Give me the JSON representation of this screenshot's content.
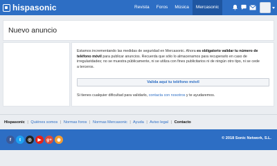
{
  "header": {
    "logo_text": "hispasonic",
    "nav": [
      "Revista",
      "Foros",
      "Música",
      "Mercasonic"
    ],
    "icons": [
      "bell-icon",
      "chat-icon",
      "mail-icon"
    ]
  },
  "page": {
    "title": "Nuevo anuncio"
  },
  "notice": {
    "part1": "Estamos incrementando las medidas de seguridad en Mercasonic. Ahora ",
    "bold": "es obligatorio validar tu número de teléfono móvil",
    "part2": " para publicar anuncios. Recuerda que sólo lo almacenamos para recuperarlo en caso de irregularidades; no se muestra públicamente, ni se utiliza con fines publicitarios ni de ningún otro tipo, ni se cede a terceros."
  },
  "verify_button": "Valida aquí tu teléfono móvil",
  "help": {
    "before": "Si tienes cualquier dificultad para validarlo, ",
    "link": "contacta con nosotros",
    "after": " y te ayudaremos."
  },
  "footer": {
    "brand": "Hispasonic",
    "links": [
      "Quiénes somos",
      "Normas foros",
      "Normas Mercasonic",
      "Ayuda",
      "Aviso legal"
    ],
    "contact": "Contacto",
    "separator": "|"
  },
  "social": [
    {
      "name": "facebook-icon",
      "glyph": "f",
      "color": "#3b5998"
    },
    {
      "name": "twitter-icon",
      "glyph": "t",
      "color": "#1da1f2"
    },
    {
      "name": "instagram-icon",
      "glyph": "◎",
      "color": "#222222"
    },
    {
      "name": "youtube-icon",
      "glyph": "▶",
      "color": "#e62117"
    },
    {
      "name": "google-plus-icon",
      "glyph": "g+",
      "color": "#dd4b39"
    },
    {
      "name": "rss-icon",
      "glyph": "◉",
      "color": "#f39c32"
    }
  ],
  "copyright": "© 2018 Sonic Network, S.L.",
  "colors": {
    "brand_blue": "#2d6ec4",
    "active_tab": "#1f56a1"
  }
}
